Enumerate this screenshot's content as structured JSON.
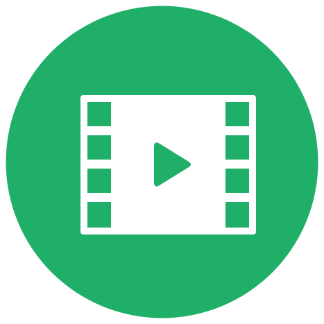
{
  "icon": {
    "name": "video-film-icon",
    "background_color": "#1FAF68",
    "foreground_color": "#FFFFFF"
  }
}
